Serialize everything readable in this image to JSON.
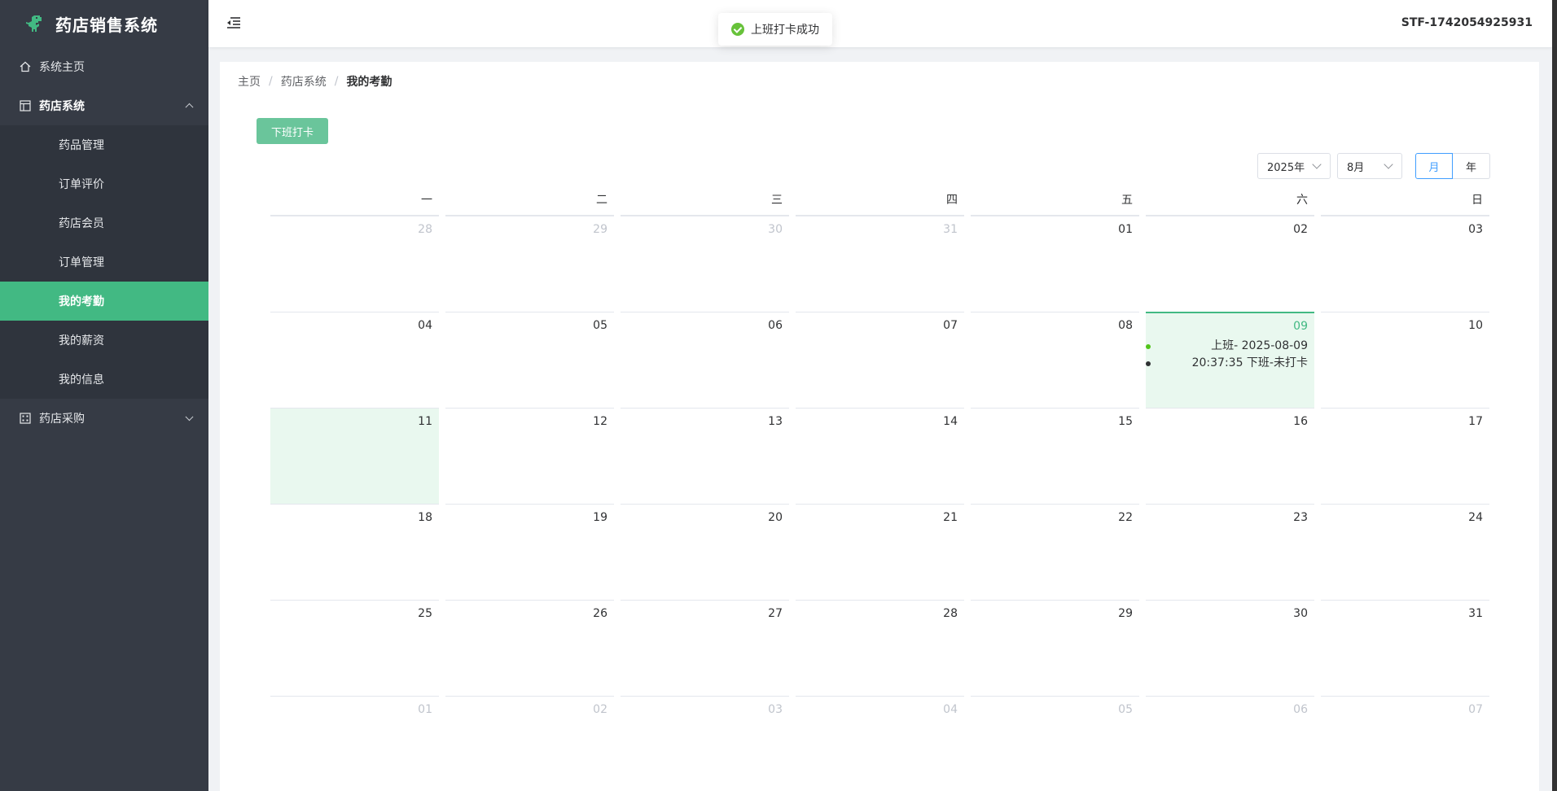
{
  "app": {
    "title": "药店销售系统"
  },
  "sidebar": {
    "items": [
      {
        "label": "系统主页",
        "icon": "home-icon"
      },
      {
        "label": "药店系统",
        "icon": "layout-icon",
        "expanded": true,
        "children": [
          {
            "label": "药品管理"
          },
          {
            "label": "订单评价"
          },
          {
            "label": "药店会员"
          },
          {
            "label": "订单管理"
          },
          {
            "label": "我的考勤",
            "active": true
          },
          {
            "label": "我的薪资"
          },
          {
            "label": "我的信息"
          }
        ]
      },
      {
        "label": "药店采购",
        "icon": "grid-icon",
        "expanded": false
      }
    ]
  },
  "header": {
    "user_id": "STF-1742054925931"
  },
  "toast": {
    "message": "上班打卡成功",
    "type": "success"
  },
  "breadcrumb": {
    "items": [
      "主页",
      "药店系统",
      "我的考勤"
    ],
    "separator": "/"
  },
  "toolbar": {
    "clockout_label": "下班打卡"
  },
  "calendar": {
    "year_label": "2025年",
    "month_label": "8月",
    "modes": [
      "月",
      "年"
    ],
    "active_mode": "月",
    "weekdays": [
      "一",
      "二",
      "三",
      "四",
      "五",
      "六",
      "日"
    ],
    "weeks": [
      [
        "28",
        "29",
        "30",
        "31",
        "01",
        "02",
        "03"
      ],
      [
        "04",
        "05",
        "06",
        "07",
        "08",
        "09",
        "10"
      ],
      [
        "11",
        "12",
        "13",
        "14",
        "15",
        "16",
        "17"
      ],
      [
        "18",
        "19",
        "20",
        "21",
        "22",
        "23",
        "24"
      ],
      [
        "25",
        "26",
        "27",
        "28",
        "29",
        "30",
        "31"
      ],
      [
        "01",
        "02",
        "03",
        "04",
        "05",
        "06",
        "07"
      ]
    ],
    "today_event": {
      "line1": "上班- 2025-08-09",
      "line2": "20:37:35 下班-未打卡"
    }
  },
  "colors": {
    "sidebar_bg": "#363b45",
    "accent_green": "#42b983",
    "button_green": "#6ac59b",
    "primary_blue": "#409eff",
    "success_green": "#67c23a"
  }
}
